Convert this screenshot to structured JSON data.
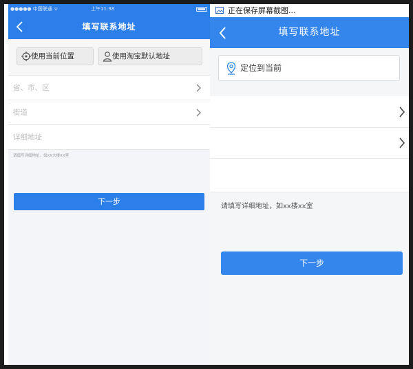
{
  "left_screen": {
    "status_bar": {
      "carrier": "●●●●● 中国联通 ᯤ",
      "time": "上午11:38"
    },
    "header": {
      "title": "填写联系地址"
    },
    "location_buttons": [
      {
        "label": "使用当前位置",
        "icon": "locate-crosshair-icon"
      },
      {
        "label": "使用淘宝默认地址",
        "icon": "person-icon"
      }
    ],
    "fields": [
      {
        "placeholder": "省、市、区",
        "has_chevron": true
      },
      {
        "placeholder": "街道",
        "has_chevron": true
      },
      {
        "placeholder": "详细地址",
        "has_chevron": false
      }
    ],
    "hint": "请填写详细地址，如XX大楼XX室",
    "next_button": "下一步"
  },
  "right_screen": {
    "notification": {
      "text": "正在保存屏幕截图...",
      "icon": "image-icon"
    },
    "header": {
      "title": "填写联系地址"
    },
    "locate_button": {
      "label": "定位到当前",
      "icon": "location-pin-icon"
    },
    "hint": "请填写详细地址，如xx楼xx室",
    "next_button": "下一步"
  },
  "colors": {
    "primary_blue": "#2c7ee9",
    "primary_blue_right": "#3486ec",
    "page_bg": "#f4f5f9"
  }
}
